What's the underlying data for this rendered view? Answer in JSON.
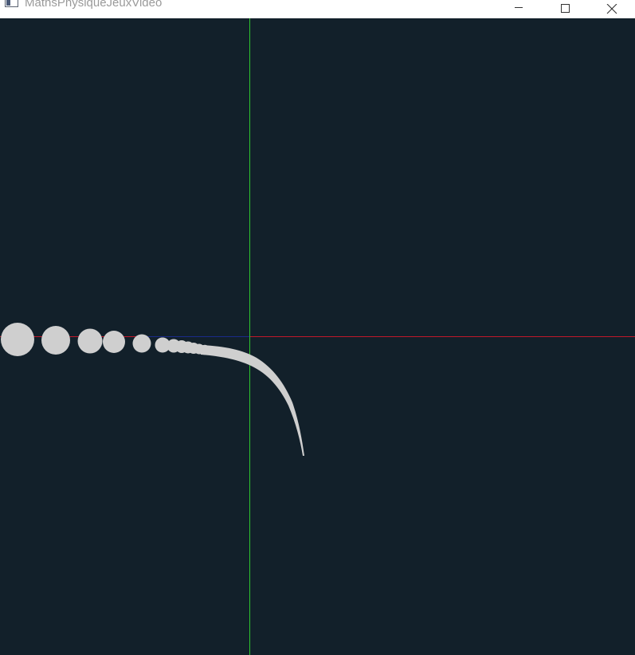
{
  "window": {
    "title": "MathsPhysiqueJeuxVideo",
    "icon": "app-window-icon",
    "controls": [
      "minimize-icon",
      "maximize-icon",
      "close-icon"
    ]
  },
  "scene": {
    "background": "#12202a",
    "axis_colors": {
      "x_axis": "#c0182a",
      "y_axis": "#2ec42e",
      "x_axis_negative_overlay": "#1a2a8a"
    },
    "sphere_color": "#cfcfcf"
  }
}
